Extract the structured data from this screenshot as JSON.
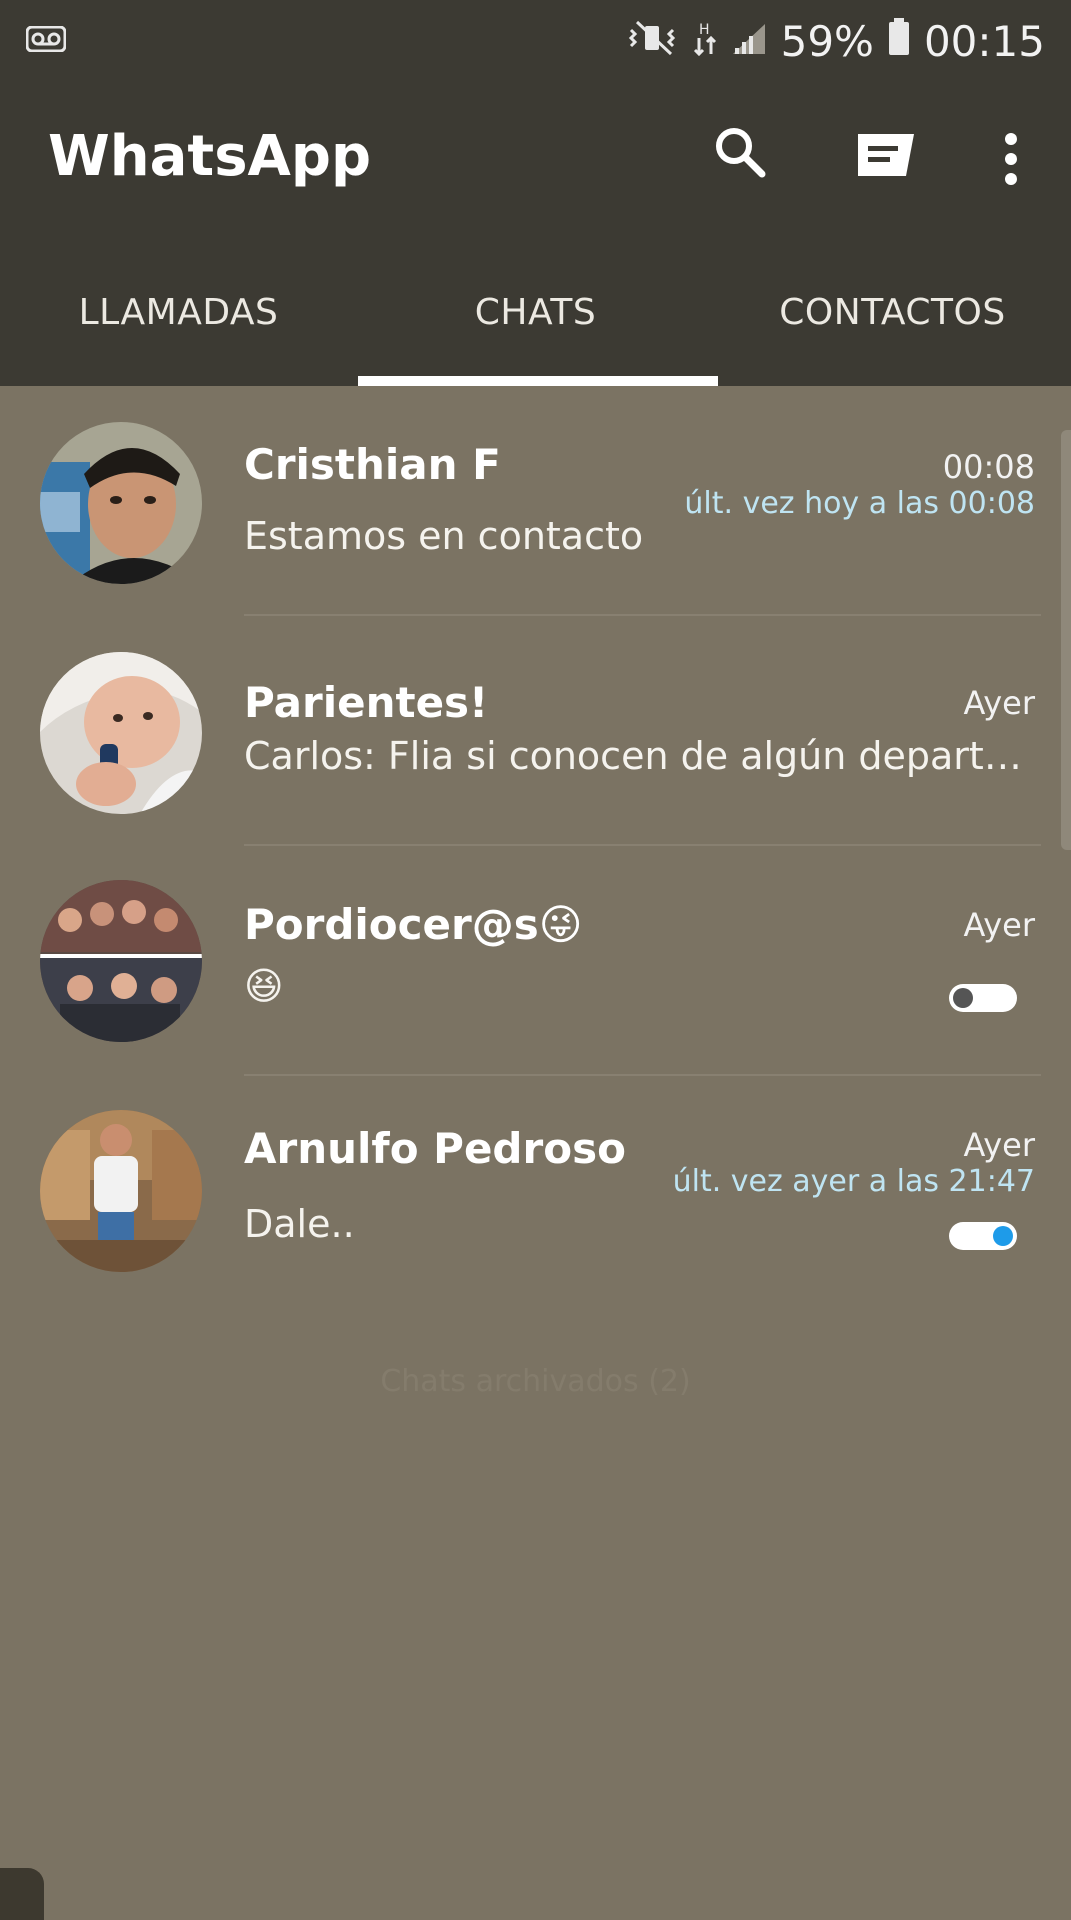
{
  "status_bar": {
    "battery": "59%",
    "time": "00:15",
    "icons": [
      "voicemail-icon",
      "mute-vibrate-icon",
      "data-arrows-icon",
      "signal-icon",
      "battery-icon"
    ]
  },
  "app_bar": {
    "title": "WhatsApp",
    "actions": [
      "search-icon",
      "new-chat-icon",
      "more-vert-icon"
    ]
  },
  "tabs": [
    {
      "label": "LLAMADAS"
    },
    {
      "label": "CHATS",
      "selected": true
    },
    {
      "label": "CONTACTOS"
    }
  ],
  "chats": [
    {
      "name": "Cristhian F",
      "time": "00:08",
      "status": "últ. vez hoy a las 00:08",
      "message": "Estamos en contacto"
    },
    {
      "name": "Parientes!",
      "time": "Ayer",
      "message": "Carlos: Flia si conocen de algún departa..."
    },
    {
      "name": "Pordiocer@s",
      "name_emoji": "😜",
      "time": "Ayer",
      "message": "😆",
      "toggle": "off"
    },
    {
      "name": "Arnulfo Pedroso",
      "time": "Ayer",
      "status": "últ. vez ayer a las 21:47",
      "message": "Dale..",
      "toggle": "on"
    }
  ],
  "footer_hint": "Chats archivados (2)",
  "colors": {
    "app_bar": "#3c3a33",
    "background": "#7b7363",
    "status_text": "#bfe4f2",
    "toggle_on": "#1e9be9"
  }
}
